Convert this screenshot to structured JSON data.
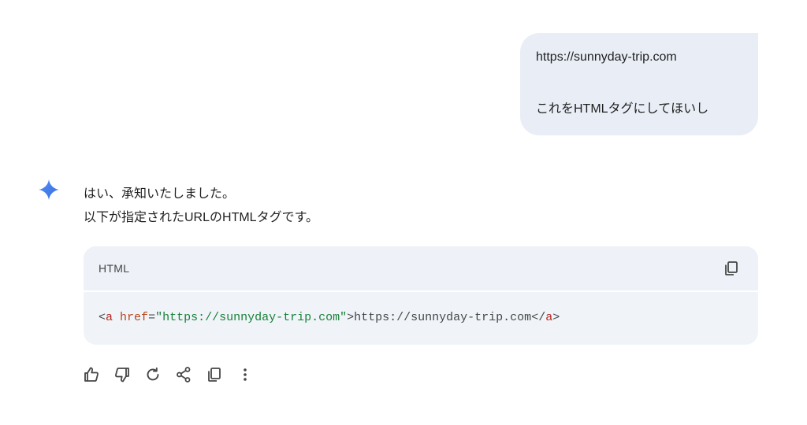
{
  "user_message": {
    "line1": "https://sunnyday-trip.com",
    "line2": "これをHTMLタグにしてほいし"
  },
  "response": {
    "line1": "はい、承知いたしました。",
    "line2": "以下が指定されたURLのHTMLタグです。"
  },
  "code_block": {
    "language": "HTML",
    "code": {
      "lt1": "<",
      "tag_open": "a",
      "space": " ",
      "attr": "href",
      "eq": "=",
      "value": "\"https://sunnyday-trip.com\"",
      "gt1": ">",
      "text": "https://sunnyday-trip.com",
      "lt2": "</",
      "tag_close": "a",
      "gt2": ">"
    }
  },
  "icons": {
    "gemini": "gemini-spark-icon",
    "copy_code": "copy-icon",
    "thumbs_up": "thumbs-up-icon",
    "thumbs_down": "thumbs-down-icon",
    "regenerate": "refresh-icon",
    "share": "share-icon",
    "copy": "copy-icon",
    "more": "more-vert-icon"
  },
  "colors": {
    "user_bubble": "#e9eef6",
    "code_bg": "#f0f4f9",
    "tag": "#b3261e",
    "attr": "#b5461a",
    "string": "#188038",
    "icon": "#444746"
  }
}
